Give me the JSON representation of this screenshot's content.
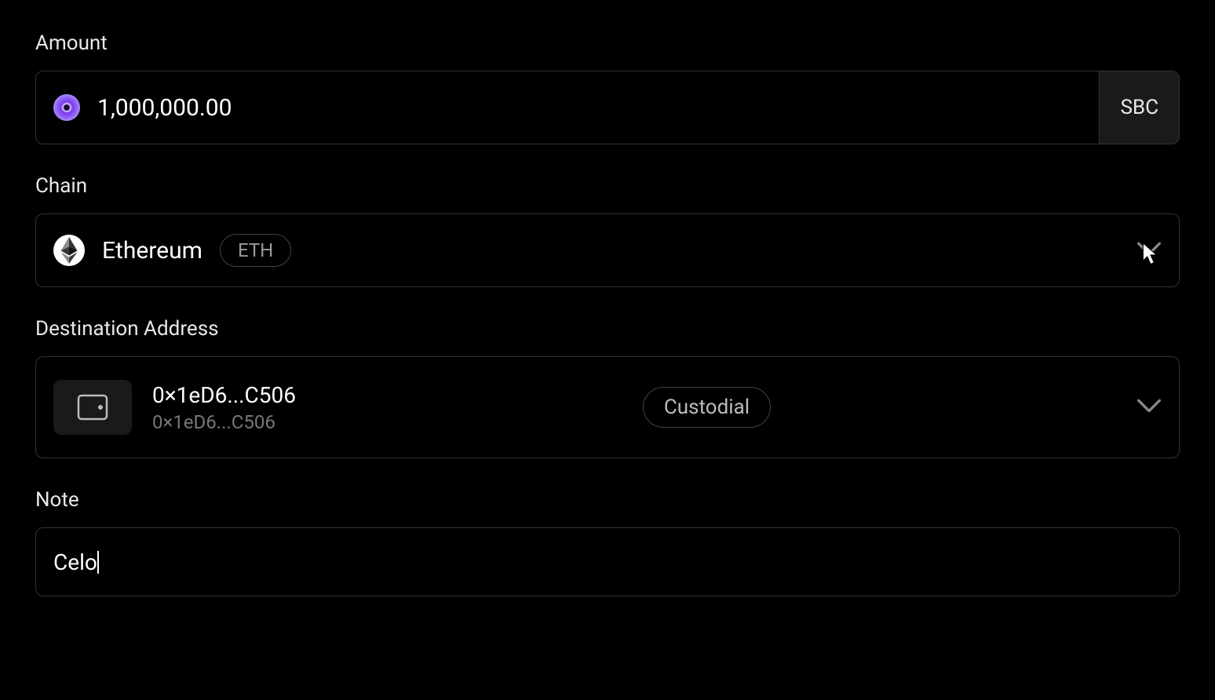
{
  "amount": {
    "label": "Amount",
    "value": "1,000,000.00",
    "currency": "SBC"
  },
  "chain": {
    "label": "Chain",
    "name": "Ethereum",
    "symbol": "ETH"
  },
  "destination": {
    "label": "Destination Address",
    "address_primary": "0×1eD6...C506",
    "address_secondary": "0×1eD6...C506",
    "badge": "Custodial"
  },
  "note": {
    "label": "Note",
    "value": "Celo"
  }
}
